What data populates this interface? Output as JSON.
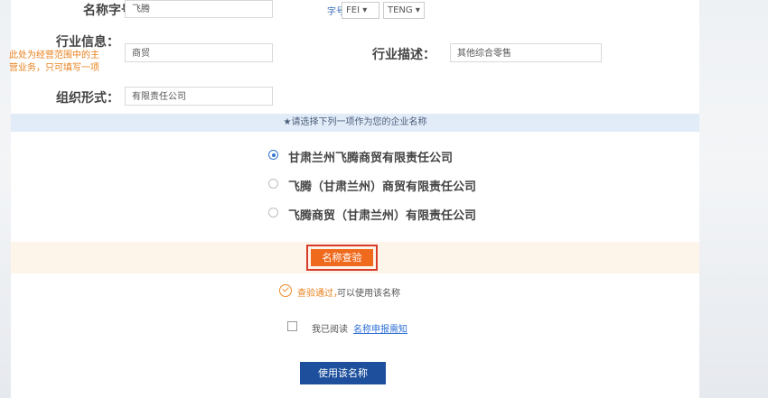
{
  "form": {
    "zihao_label": "名称字号：",
    "zihao_value": "飞腾",
    "pinyin_label": "字号拼音为：",
    "pinyin_1": "FEI ▾",
    "pinyin_2": "TENG ▾",
    "industry_label": "行业信息：",
    "industry_note_line1": "此处为经营范围中的主",
    "industry_note_line2": "营业务，只可填写一项",
    "industry_value": "商贸",
    "industry_desc_label": "行业描述：",
    "industry_desc_value": "其他综合零售",
    "org_label": "组织形式：",
    "org_value": "有限责任公司"
  },
  "choose_banner": "★请选择下列一项作为您的企业名称",
  "options": [
    {
      "label": "甘肃兰州飞腾商贸有限责任公司",
      "selected": true
    },
    {
      "label": "飞腾（甘肃兰州）商贸有限责任公司",
      "selected": false
    },
    {
      "label": "飞腾商贸（甘肃兰州）有限责任公司",
      "selected": false
    }
  ],
  "check_button": "名称查验",
  "pass_msg_1": "查验通过，",
  "pass_msg_2": "可以使用该名称",
  "agree_text": "我已阅读",
  "agree_link": "名称申报需知",
  "use_button": "使用该名称",
  "colors": {
    "accent_orange": "#ef6a1d",
    "highlight_red": "#d93b2b",
    "primary_blue": "#1d4f9c",
    "link_blue": "#2f6fd6",
    "note_orange": "#e8801c"
  }
}
